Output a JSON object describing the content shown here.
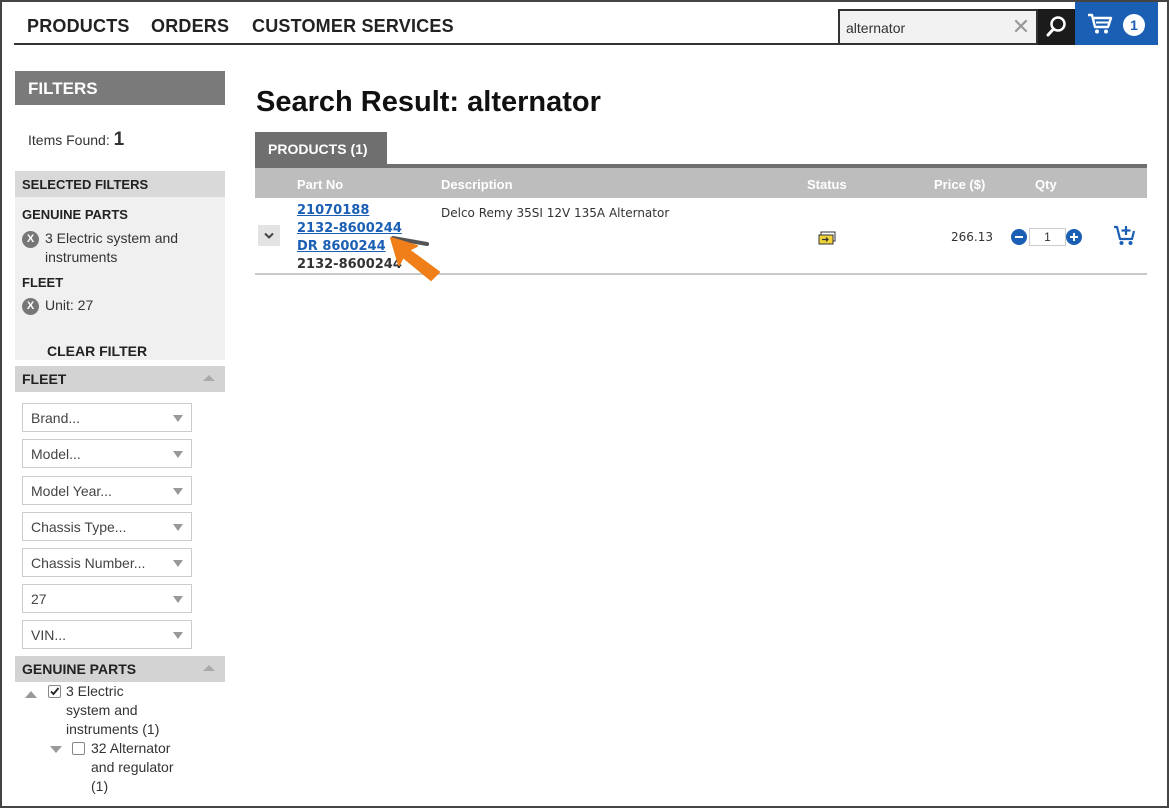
{
  "nav": {
    "products": "PRODUCTS",
    "orders": "ORDERS",
    "customer_services": "CUSTOMER SERVICES"
  },
  "search": {
    "value": "alternator",
    "clear_icon": "close-icon",
    "search_icon": "search-icon"
  },
  "cart": {
    "icon": "cart-icon",
    "count": "1"
  },
  "sidebar": {
    "filters_title": "FILTERS",
    "items_found_label": "Items Found:",
    "items_found_count": "1",
    "selected_filters_title": "SELECTED FILTERS",
    "selected": [
      {
        "group": "GENUINE PARTS",
        "line1": "3 Electric system and",
        "line2": "instruments"
      },
      {
        "group": "FLEET",
        "line1": "Unit: 27",
        "line2": ""
      }
    ],
    "clear_filter": "CLEAR FILTER",
    "fleet_title": "FLEET",
    "fleet_dropdowns": [
      "Brand...",
      "Model...",
      "Model Year...",
      "Chassis Type...",
      "Chassis Number...",
      "27",
      "VIN..."
    ],
    "genuine_parts_title": "GENUINE PARTS",
    "tree": [
      {
        "lines": [
          "3 Electric",
          "system and",
          "instruments (1)"
        ],
        "checked": true
      },
      {
        "lines": [
          "32 Alternator",
          "and regulator",
          "(1)"
        ],
        "checked": false
      }
    ]
  },
  "main": {
    "title": "Search Result: alternator",
    "tab_label": "PRODUCTS (1)",
    "columns": {
      "part_no": "Part No",
      "description": "Description",
      "status": "Status",
      "price": "Price ($)",
      "qty": "Qty"
    },
    "rows": [
      {
        "part_links": [
          "21070188",
          "2132-8600244",
          "DR 8600244"
        ],
        "part_plain": "2132-8600244",
        "description": "Delco Remy 35SI 12V 135A Alternator",
        "status_icon": "stock-status-icon",
        "price": "266.13",
        "qty": "1"
      }
    ]
  },
  "colors": {
    "accent": "#1a5fb4",
    "pointer": "#f07f1a",
    "header_grey": "#7a7a7a"
  }
}
